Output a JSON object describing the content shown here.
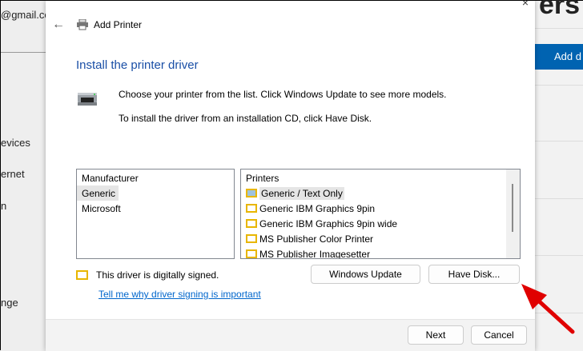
{
  "background": {
    "left_texts": [
      "@gmail.co",
      "evices",
      "ernet",
      "n",
      "nge"
    ],
    "right_title": "ers",
    "add_button": "Add d"
  },
  "dialog": {
    "title": "Add Printer",
    "heading": "Install the printer driver",
    "instruction1": "Choose your printer from the list. Click Windows Update to see more models.",
    "instruction2": "To install the driver from an installation CD, click Have Disk.",
    "manufacturer": {
      "header": "Manufacturer",
      "items": [
        "Generic",
        "Microsoft"
      ],
      "selected": "Generic"
    },
    "printers": {
      "header": "Printers",
      "items": [
        "Generic / Text Only",
        "Generic IBM Graphics 9pin",
        "Generic IBM Graphics 9pin wide",
        "MS Publisher Color Printer",
        "MS Publisher Imagesetter"
      ],
      "selected": "Generic / Text Only"
    },
    "signed_text": "This driver is digitally signed.",
    "signing_link": "Tell me why driver signing is important",
    "windows_update": "Windows Update",
    "have_disk": "Have Disk...",
    "next": "Next",
    "cancel": "Cancel",
    "close_glyph": "×",
    "back_glyph": "←"
  },
  "colors": {
    "heading": "#1a4fa6",
    "link": "#0066cc",
    "arrow": "#e00000",
    "accent": "#0063b1"
  }
}
